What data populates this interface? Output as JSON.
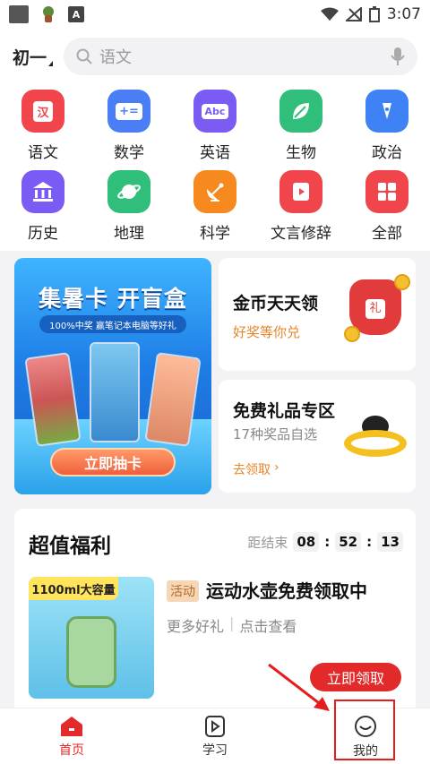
{
  "status": {
    "time": "3:07",
    "app_icon_letter": "A"
  },
  "header": {
    "grade": "初一",
    "search_placeholder": "语文"
  },
  "subjects": [
    {
      "label": "语文",
      "icon": "hanzi-icon",
      "glyph": "汉",
      "color": "#f0454a"
    },
    {
      "label": "数学",
      "icon": "math-icon",
      "glyph": "+=",
      "color": "#4a7ef5"
    },
    {
      "label": "英语",
      "icon": "abc-icon",
      "glyph": "Abc",
      "color": "#7a5cf5"
    },
    {
      "label": "生物",
      "icon": "leaf-icon",
      "glyph": "",
      "color": "#2fbf7a"
    },
    {
      "label": "政治",
      "icon": "pen-icon",
      "glyph": "",
      "color": "#3e82f5"
    },
    {
      "label": "历史",
      "icon": "temple-icon",
      "glyph": "",
      "color": "#7a5cf5"
    },
    {
      "label": "地理",
      "icon": "planet-icon",
      "glyph": "",
      "color": "#2fbf7a"
    },
    {
      "label": "科学",
      "icon": "satellite-icon",
      "glyph": "",
      "color": "#f78a1e"
    },
    {
      "label": "文言修辞",
      "icon": "play-book-icon",
      "glyph": "",
      "color": "#f0454a"
    },
    {
      "label": "全部",
      "icon": "grid-icon",
      "glyph": "",
      "color": "#f0454a"
    }
  ],
  "promo_left": {
    "title": "集暑卡 开盲盒",
    "subtitle": "100%中奖 赢笔记本电脑等好礼",
    "button": "立即抽卡"
  },
  "promo_coins": {
    "title": "金币天天领",
    "subtitle": "好奖等你兑",
    "subtitle_color": "#e8862a"
  },
  "promo_gifts": {
    "title": "免费礼品专区",
    "subtitle": "17种奖品自选",
    "link": "去领取",
    "link_color": "#e8862a"
  },
  "welfare": {
    "title": "超值福利",
    "countdown_label": "距结束",
    "hours": "08",
    "minutes": "52",
    "seconds": "13",
    "image_tag": "1100ml大容量",
    "badge": "活动",
    "item_name": "运动水壶免费领取中",
    "more": "更多好礼",
    "view": "点击查看",
    "button": "立即领取"
  },
  "tabs": [
    {
      "label": "首页",
      "icon": "home-icon",
      "active": true
    },
    {
      "label": "学习",
      "icon": "play-book-icon",
      "active": false
    },
    {
      "label": "我的",
      "icon": "face-icon",
      "active": false
    }
  ],
  "annotation_color": "#e51d1d"
}
